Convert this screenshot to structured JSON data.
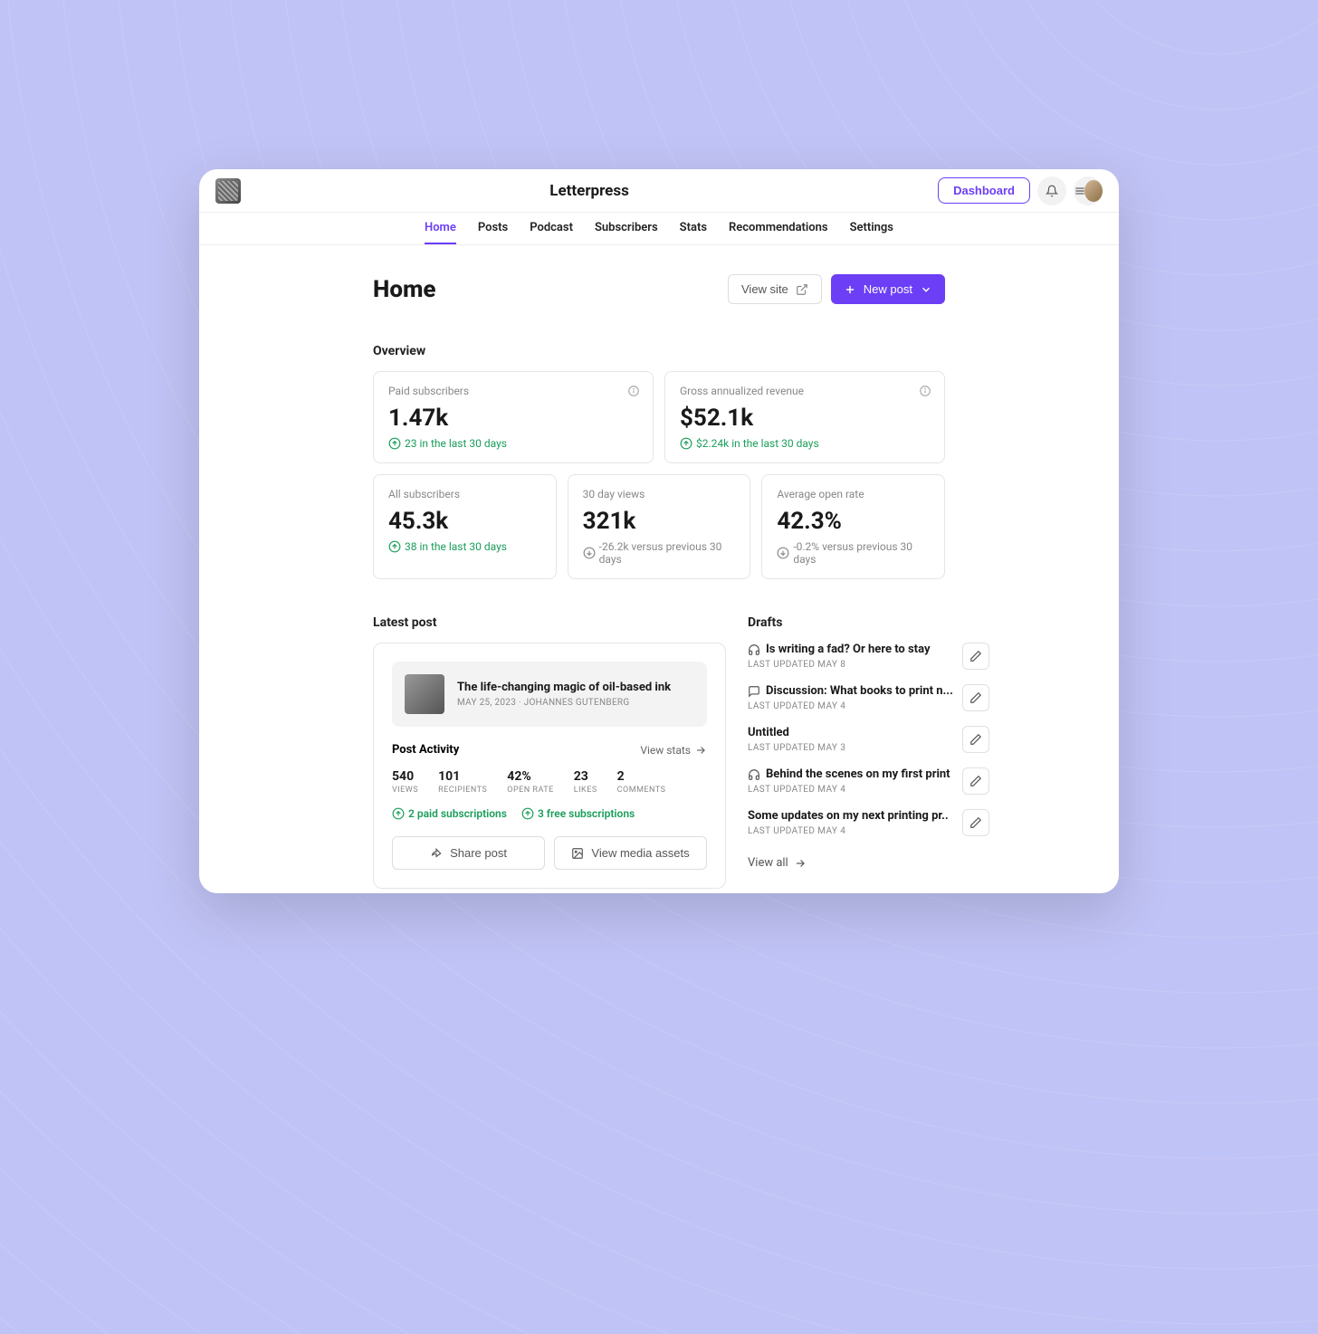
{
  "app": {
    "title": "Letterpress"
  },
  "topbar": {
    "dashboard": "Dashboard"
  },
  "nav": {
    "tabs": [
      "Home",
      "Posts",
      "Podcast",
      "Subscribers",
      "Stats",
      "Recommendations",
      "Settings"
    ],
    "active": 0
  },
  "page": {
    "title": "Home",
    "view_site": "View site",
    "new_post": "New post"
  },
  "overview": {
    "label": "Overview",
    "paid_subs": {
      "label": "Paid subscribers",
      "value": "1.47k",
      "delta": "23 in the last 30 days",
      "dir": "up"
    },
    "revenue": {
      "label": "Gross annualized revenue",
      "value": "$52.1k",
      "delta": "$2.24k in the last 30 days",
      "dir": "up"
    },
    "all_subs": {
      "label": "All subscribers",
      "value": "45.3k",
      "delta": "38 in the last 30 days",
      "dir": "up"
    },
    "views": {
      "label": "30 day views",
      "value": "321k",
      "delta": "-26.2k versus previous 30 days",
      "dir": "down"
    },
    "open_rate": {
      "label": "Average open rate",
      "value": "42.3%",
      "delta": "-0.2% versus previous 30 days",
      "dir": "down"
    }
  },
  "latest_post": {
    "section_label": "Latest post",
    "title": "The life-changing magic of oil-based ink",
    "date": "MAY 25, 2023",
    "author": "JOHANNES GUTENBERG",
    "activity_label": "Post Activity",
    "view_stats": "View stats",
    "stats": {
      "views": {
        "value": "540",
        "label": "VIEWS"
      },
      "recipients": {
        "value": "101",
        "label": "RECIPIENTS"
      },
      "open_rate": {
        "value": "42%",
        "label": "OPEN RATE"
      },
      "likes": {
        "value": "23",
        "label": "LIKES"
      },
      "comments": {
        "value": "2",
        "label": "COMMENTS"
      }
    },
    "paid_delta": "2 paid subscriptions",
    "free_delta": "3 free subscriptions",
    "share_label": "Share post",
    "media_label": "View media assets"
  },
  "drafts": {
    "section_label": "Drafts",
    "view_all": "View all",
    "items": [
      {
        "icon": "headphones",
        "title": "Is writing a fad? Or here to stay",
        "updated": "LAST UPDATED MAY 8"
      },
      {
        "icon": "chat",
        "title": "Discussion: What books to print n...",
        "updated": "LAST UPDATED MAY 4"
      },
      {
        "icon": "none",
        "title": "Untitled",
        "updated": "LAST UPDATED MAY 3"
      },
      {
        "icon": "headphones",
        "title": "Behind the scenes on my first print",
        "updated": "LAST UPDATED MAY 4"
      },
      {
        "icon": "none",
        "title": "Some updates on my next printing pr..",
        "updated": "LAST UPDATED MAY 4"
      }
    ]
  }
}
